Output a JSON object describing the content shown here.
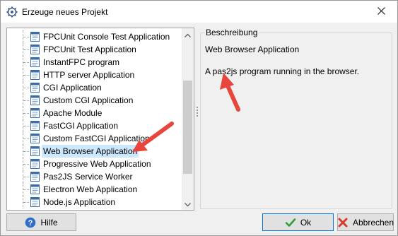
{
  "window": {
    "title": "Erzeuge neues Projekt",
    "icon": "gear-icon",
    "close_icon": "close-icon"
  },
  "project_list": {
    "items": [
      {
        "label": "FPCUnit Console Test Application",
        "selected": false
      },
      {
        "label": "FPCUnit Test Application",
        "selected": false
      },
      {
        "label": "InstantFPC program",
        "selected": false
      },
      {
        "label": "HTTP server Application",
        "selected": false
      },
      {
        "label": "CGI Application",
        "selected": false
      },
      {
        "label": "Custom CGI Application",
        "selected": false
      },
      {
        "label": "Apache Module",
        "selected": false
      },
      {
        "label": "FastCGI Application",
        "selected": false
      },
      {
        "label": "Custom FastCGI Application",
        "selected": false
      },
      {
        "label": "Web Browser Application",
        "selected": true
      },
      {
        "label": "Progressive Web Application",
        "selected": false
      },
      {
        "label": "Pas2JS Service Worker",
        "selected": false
      },
      {
        "label": "Electron Web Application",
        "selected": false
      },
      {
        "label": "Node.js Application",
        "selected": false
      }
    ]
  },
  "description": {
    "legend": "Beschreibung",
    "title": "Web Browser Application",
    "text": "A pas2js program running in the browser."
  },
  "buttons": {
    "help": "Hilfe",
    "ok": "Ok",
    "cancel": "Abbrechen"
  },
  "colors": {
    "selection": "#cce8ff",
    "annotation_arrow": "#e8453c",
    "ok_check": "#2e9e3a",
    "cancel_x": "#d83b2e",
    "help_icon": "#2e6ec8"
  }
}
